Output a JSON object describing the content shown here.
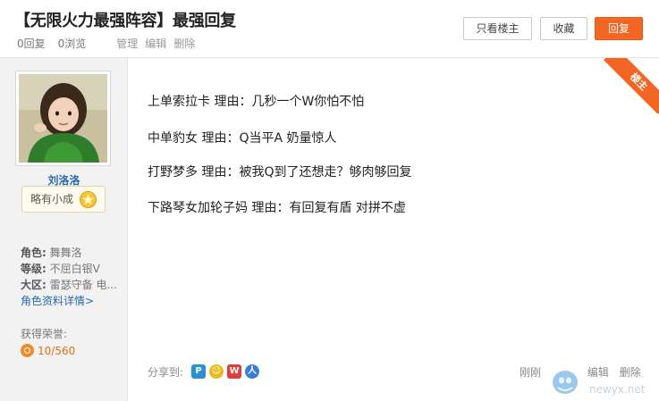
{
  "header": {
    "title": "【无限火力最强阵容】最强回复",
    "replies": "0回复",
    "views": "0浏览",
    "admin_manage": "管理",
    "admin_edit": "编辑",
    "admin_delete": "删除",
    "btn_only_owner": "只看楼主",
    "btn_favorite": "收藏",
    "btn_reply": "回复"
  },
  "author": {
    "name": "刘洛洛",
    "badge": "略有小成",
    "role_label": "角色:",
    "role_value": "舞舞洛",
    "level_label": "等级:",
    "level_value": "不屈白银V",
    "server_label": "大区:",
    "server_value": "雷瑟守备 电...",
    "detail_link": "角色资料详情>",
    "honor_label": "获得荣誉:",
    "honor_value": "10/560"
  },
  "post": {
    "ribbon": "楼主",
    "lines": [
      "上单索拉卡  理由：几秒一个W你怕不怕",
      "中单豹女   理由：Q当平A 奶量惊人",
      "打野梦多 理由：被我Q到了还想走？够肉够回复",
      "下路琴女加轮子妈  理由：有回复有盾 对拼不虚"
    ],
    "share_label": "分享到:",
    "time": "刚刚",
    "action_edit": "编辑",
    "action_delete": "删除"
  },
  "watermark": {
    "text": "newyx.net"
  },
  "colors": {
    "accent": "#f26522",
    "link": "#2a6aa5",
    "sidebar_bg": "#f2f2f2"
  },
  "icons": [
    "star-icon",
    "honor-coin-icon",
    "share-qzone-icon",
    "share-friend-icon",
    "share-weibo-icon",
    "share-renren-icon"
  ]
}
